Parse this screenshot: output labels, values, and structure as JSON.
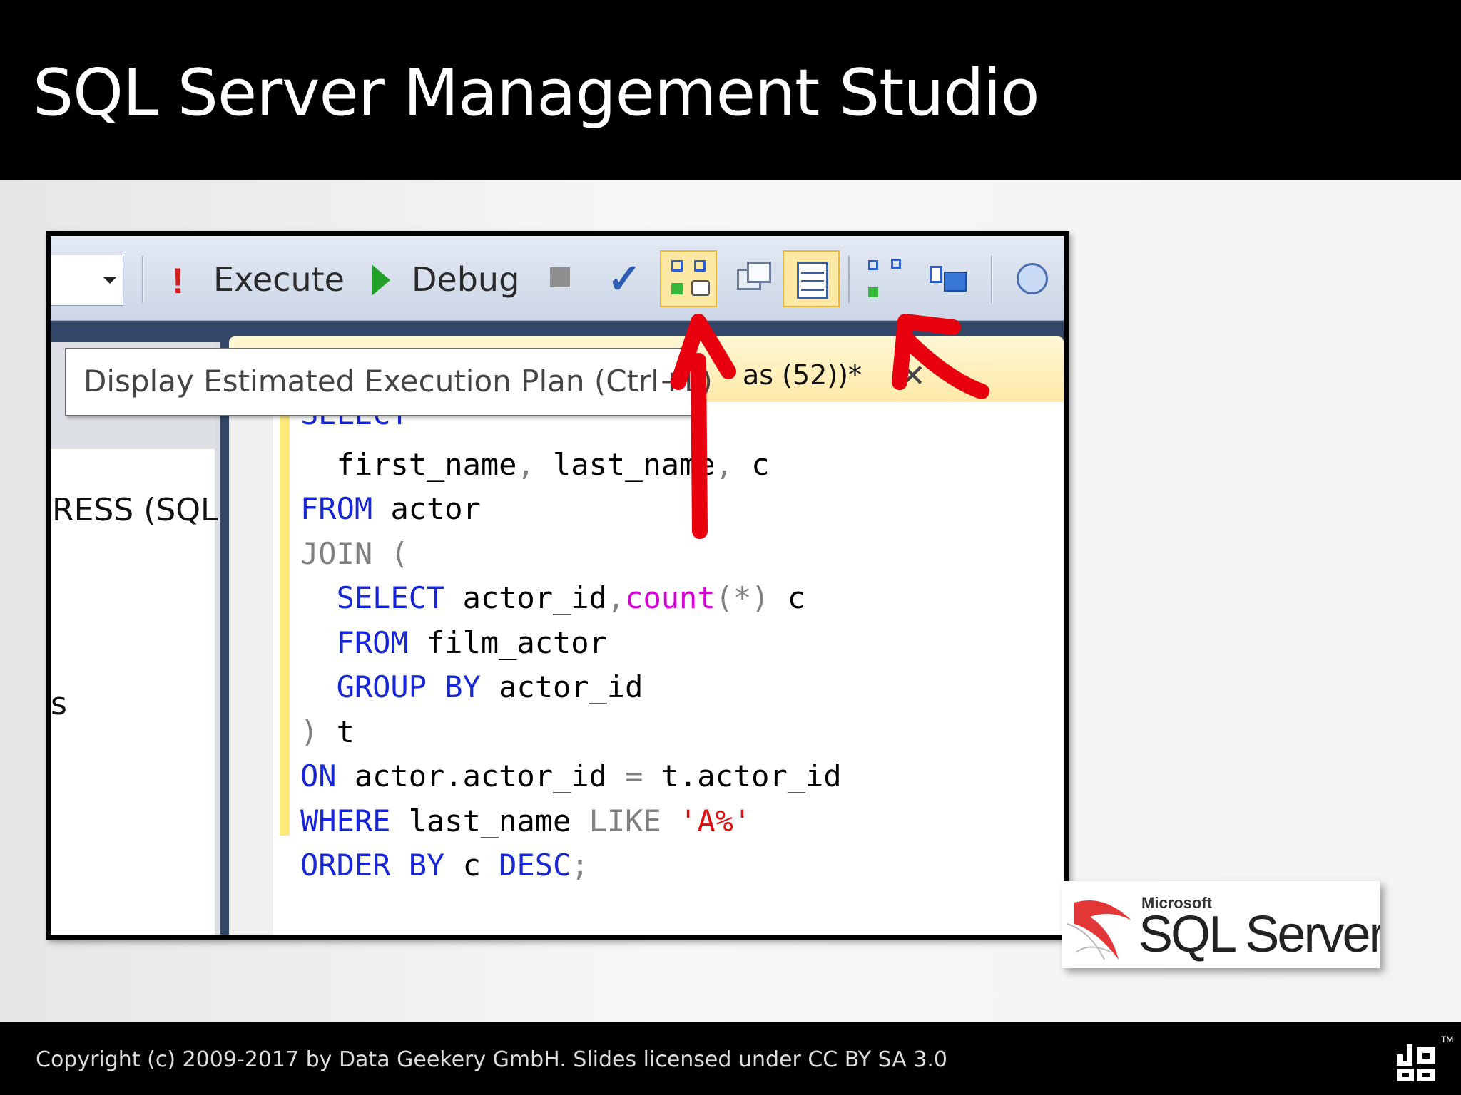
{
  "header": {
    "title": "SQL Server Management Studio"
  },
  "toolbar": {
    "execute_label": "Execute",
    "debug_label": "Debug",
    "icons": {
      "execute": "!",
      "check": "✓"
    }
  },
  "tooltip": {
    "text": "Display Estimated Execution Plan (Ctrl+L)"
  },
  "tab": {
    "label": "as (52))*",
    "close": "✕"
  },
  "sidepanel": {
    "server_text": "RESS (SQL",
    "item_text": "s"
  },
  "code": {
    "lines": [
      [
        {
          "c": "kw",
          "t": "SELECT"
        }
      ],
      [
        {
          "c": "tx",
          "t": "  first_name"
        },
        {
          "c": "gr",
          "t": ","
        },
        {
          "c": "tx",
          "t": " last_name"
        },
        {
          "c": "gr",
          "t": ","
        },
        {
          "c": "tx",
          "t": " c"
        }
      ],
      [
        {
          "c": "kw",
          "t": "FROM"
        },
        {
          "c": "tx",
          "t": " actor"
        }
      ],
      [
        {
          "c": "gr",
          "t": "JOIN ("
        }
      ],
      [
        {
          "c": "tx",
          "t": "  "
        },
        {
          "c": "kw",
          "t": "SELECT"
        },
        {
          "c": "tx",
          "t": " actor_id"
        },
        {
          "c": "gr",
          "t": ","
        },
        {
          "c": "fn",
          "t": "count"
        },
        {
          "c": "gr",
          "t": "(*)"
        },
        {
          "c": "tx",
          "t": " c"
        }
      ],
      [
        {
          "c": "tx",
          "t": "  "
        },
        {
          "c": "kw",
          "t": "FROM"
        },
        {
          "c": "tx",
          "t": " film_actor"
        }
      ],
      [
        {
          "c": "tx",
          "t": "  "
        },
        {
          "c": "kw",
          "t": "GROUP BY"
        },
        {
          "c": "tx",
          "t": " actor_id"
        }
      ],
      [
        {
          "c": "gr",
          "t": ")"
        },
        {
          "c": "tx",
          "t": " t"
        }
      ],
      [
        {
          "c": "kw",
          "t": "ON"
        },
        {
          "c": "tx",
          "t": " actor.actor_id "
        },
        {
          "c": "gr",
          "t": "="
        },
        {
          "c": "tx",
          "t": " t.actor_id"
        }
      ],
      [
        {
          "c": "kw",
          "t": "WHERE"
        },
        {
          "c": "tx",
          "t": " last_name "
        },
        {
          "c": "gr",
          "t": "LIKE"
        },
        {
          "c": "tx",
          "t": " "
        },
        {
          "c": "st",
          "t": "'A%'"
        }
      ],
      [
        {
          "c": "kw",
          "t": "ORDER BY"
        },
        {
          "c": "tx",
          "t": " c "
        },
        {
          "c": "kw",
          "t": "DESC"
        },
        {
          "c": "gr",
          "t": ";"
        }
      ]
    ]
  },
  "logo": {
    "microsoft": "Microsoft",
    "product": "SQL Server"
  },
  "footer": {
    "copyright": "Copyright (c) 2009-2017 by Data Geekery GmbH. Slides licensed under CC BY SA 3.0",
    "tm": "TM"
  },
  "colors": {
    "annotation_arrow": "#e8000f",
    "keyword": "#1727d6",
    "highlight": "#fde9a4"
  }
}
